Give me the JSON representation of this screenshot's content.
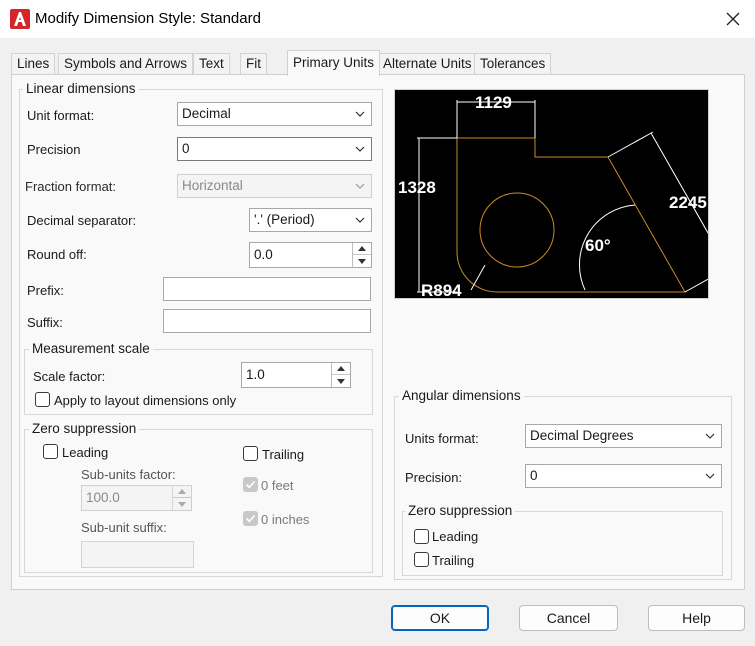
{
  "window": {
    "title": "Modify Dimension Style: Standard",
    "icon": "autocad-a-icon",
    "close_icon": "close-icon"
  },
  "tabs": [
    {
      "label": "Lines",
      "active": false
    },
    {
      "label": "Symbols and Arrows",
      "active": false
    },
    {
      "label": "Text",
      "active": false
    },
    {
      "label": "Fit",
      "active": false
    },
    {
      "label": "Primary Units",
      "active": true
    },
    {
      "label": "Alternate Units",
      "active": false
    },
    {
      "label": "Tolerances",
      "active": false
    }
  ],
  "linear": {
    "group_title": "Linear dimensions",
    "unit_format": {
      "label": "Unit format:",
      "value": "Decimal"
    },
    "precision": {
      "label": "Precision",
      "value": "0"
    },
    "fraction_format": {
      "label": "Fraction format:",
      "value": "Horizontal",
      "disabled": true
    },
    "decimal_separator": {
      "label": "Decimal separator:",
      "value": "'.' (Period)"
    },
    "round_off": {
      "label": "Round off:",
      "value": "0.0"
    },
    "prefix": {
      "label": "Prefix:",
      "value": ""
    },
    "suffix": {
      "label": "Suffix:",
      "value": ""
    },
    "measurement_scale": {
      "title": "Measurement scale",
      "scale_factor": {
        "label": "Scale factor:",
        "value": "1.0"
      },
      "apply_layout": {
        "label": "Apply to layout dimensions only",
        "checked": false
      }
    },
    "zero_suppression": {
      "title": "Zero suppression",
      "leading": {
        "label": "Leading",
        "checked": false
      },
      "trailing": {
        "label": "Trailing",
        "checked": false
      },
      "sub_units_factor": {
        "label": "Sub-units factor:",
        "value": "100.0",
        "disabled": true
      },
      "sub_unit_suffix": {
        "label": "Sub-unit suffix:",
        "value": "",
        "disabled": true
      },
      "zero_feet": {
        "label": "0 feet",
        "checked": true,
        "disabled": true
      },
      "zero_inches": {
        "label": "0 inches",
        "checked": true,
        "disabled": true
      }
    }
  },
  "preview": {
    "dim_top": "1129",
    "dim_left": "1328",
    "dim_diag": "2245",
    "dim_angle": "60°",
    "dim_radius": "R894"
  },
  "angular": {
    "group_title": "Angular dimensions",
    "units_format": {
      "label": "Units format:",
      "value": "Decimal Degrees"
    },
    "precision": {
      "label": "Precision:",
      "value": "0"
    },
    "zero_suppression": {
      "title": "Zero suppression",
      "leading": {
        "label": "Leading",
        "checked": false
      },
      "trailing": {
        "label": "Trailing",
        "checked": false
      }
    }
  },
  "buttons": {
    "ok": "OK",
    "cancel": "Cancel",
    "help": "Help"
  },
  "colors": {
    "accent": "#0067c0",
    "app_icon_red": "#d4262a",
    "preview_geometry": "#c98a2b",
    "preview_bg": "#000000"
  }
}
